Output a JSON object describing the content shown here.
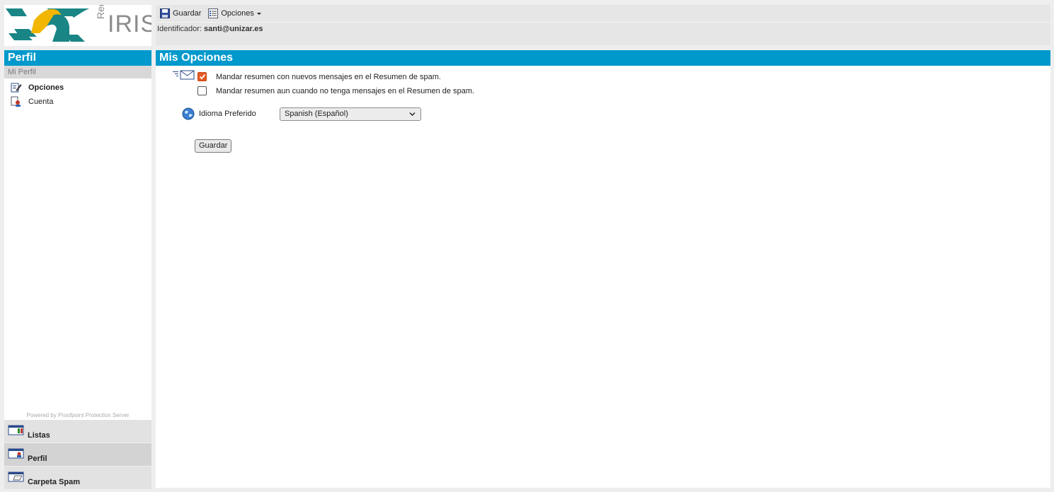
{
  "logo": {
    "brand_prefix": "Red",
    "brand_name": "IRIS"
  },
  "toolbar": {
    "save_label": "Guardar",
    "options_label": "Opciones",
    "identifier_label": "Identificador:",
    "identifier_value": "santi@unizar.es"
  },
  "sidebar": {
    "title": "Perfil",
    "subtitle": "Mi Perfil",
    "items": [
      {
        "label": "Opciones",
        "icon": "edit-options-icon",
        "active": true
      },
      {
        "label": "Cuenta",
        "icon": "account-icon",
        "active": false
      }
    ],
    "powered_by": "Powered by Proofpoint Protection Server"
  },
  "sections": [
    {
      "label": "Listas",
      "icon": "lists-icon"
    },
    {
      "label": "Perfil",
      "icon": "profile-icon",
      "selected": true
    },
    {
      "label": "Carpeta Spam",
      "icon": "spam-folder-icon"
    }
  ],
  "main": {
    "title": "Mis Opciones",
    "options": [
      {
        "label": "Mandar resumen con nuevos mensajes en el Resumen de spam.",
        "checked": true
      },
      {
        "label": "Mandar resumen aun cuando no tenga mensajes en el Resumen de spam.",
        "checked": false
      }
    ],
    "language_label": "Idioma Preferido",
    "language_value": "Spanish (Español)",
    "save_button": "Guardar"
  },
  "colors": {
    "header_blue": "#0099cc",
    "check_orange": "#e45a23"
  }
}
